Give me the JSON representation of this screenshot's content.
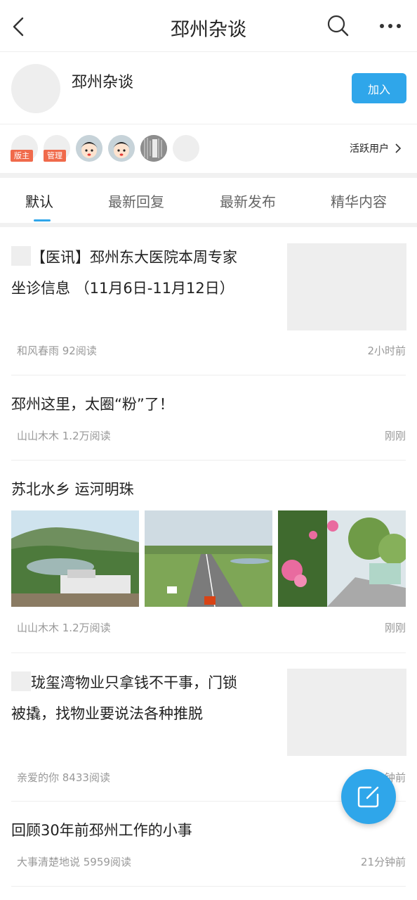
{
  "header": {
    "title": "邳州杂谈",
    "icons": {
      "back": "back-arrow-icon",
      "search": "search-icon",
      "more": "more-dots-icon"
    }
  },
  "group": {
    "name": "邳州杂谈",
    "join_label": "加入"
  },
  "members": {
    "badges": [
      "版主",
      "管理"
    ],
    "active_users_label": "活跃用户"
  },
  "tabs": [
    {
      "label": "默认"
    },
    {
      "label": "最新回复"
    },
    {
      "label": "最新发布"
    },
    {
      "label": "精华内容"
    }
  ],
  "posts": [
    {
      "title_line1": "【医讯】邳州东大医院本周专家",
      "title_line2": "坐诊信息 （11月6日-11月12日）",
      "meta": "和风春雨 92阅读",
      "time": "2小时前"
    },
    {
      "title": "邳州这里，太圈“粉”了！",
      "meta": "山山木木 1.2万阅读",
      "time": "刚刚"
    },
    {
      "title": "苏北水乡 运河明珠",
      "meta": "山山木木 1.2万阅读",
      "time": "刚刚"
    },
    {
      "title_line1": "珑玺湾物业只拿钱不干事，门锁",
      "title_line2": "被撬，找物业要说法各种推脱",
      "meta": "亲爱的你 8433阅读",
      "time": "钟前"
    },
    {
      "title": "回顾30年前邳州工作的小事",
      "meta": "大事清楚地说 5959阅读",
      "time": "21分钟前"
    }
  ],
  "colors": {
    "accent": "#2fa6ea",
    "badge": "#f06a4b",
    "muted": "#999999"
  }
}
